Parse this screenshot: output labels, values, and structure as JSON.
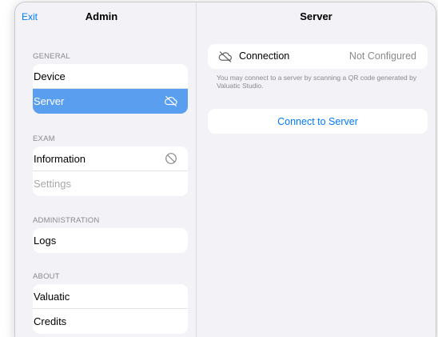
{
  "sidebar": {
    "exit_label": "Exit",
    "title": "Admin",
    "sections": {
      "general": {
        "header": "GENERAL",
        "device": "Device",
        "server": "Server"
      },
      "exam": {
        "header": "EXAM",
        "information": "Information",
        "settings": "Settings"
      },
      "administration": {
        "header": "ADMINISTRATION",
        "logs": "Logs"
      },
      "about": {
        "header": "ABOUT",
        "valuatic": "Valuatic",
        "credits": "Credits"
      }
    }
  },
  "detail": {
    "title": "Server",
    "connection_label": "Connection",
    "connection_status": "Not Configured",
    "footnote": "You may connect to a server by scanning a QR code generated by Valuatic Studio.",
    "connect_button": "Connect to Server"
  },
  "icons": {
    "server": "cloud-slash-icon",
    "information": "prohibited-icon",
    "connection": "cloud-slash-icon"
  },
  "colors": {
    "accent": "#007aff",
    "selected_row": "#5a9ef0",
    "background": "#f2f2f7"
  }
}
